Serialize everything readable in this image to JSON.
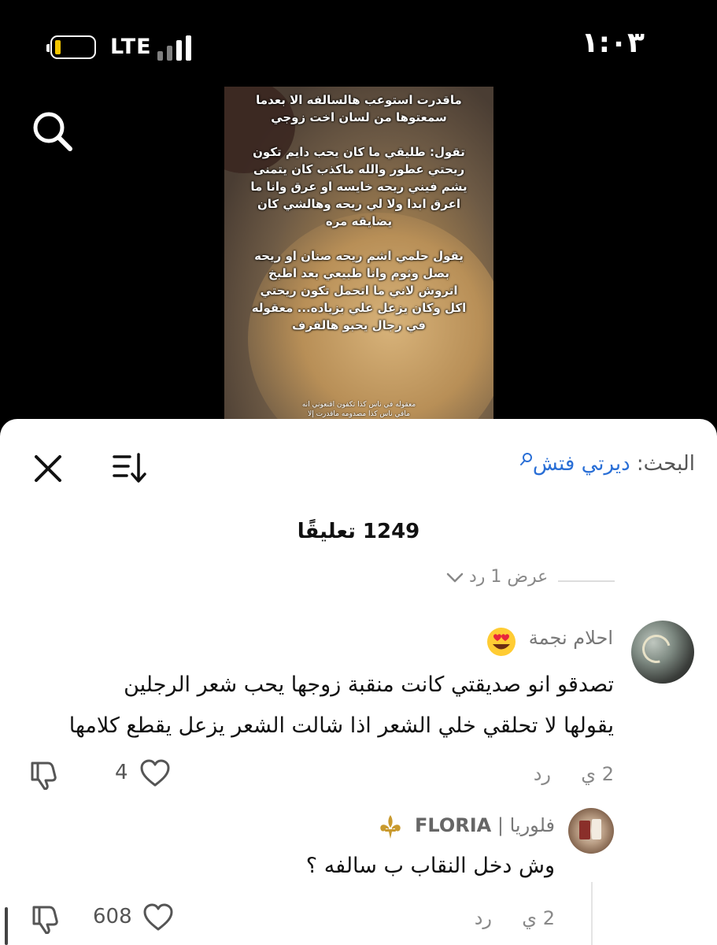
{
  "status_bar": {
    "time": "١:٠٣",
    "network": "LTE",
    "battery_level": 0.15,
    "battery_color": "#f2c500"
  },
  "video": {
    "overlay_text": "ماقدرت استوعب هالسالفه الا بعدما\nسمعتوها من لسان اخت زوجي\n\nتقول: طليقي ما كان يحب دايم تكون\nريحتي عطور والله ماكذب كان يتمنى\nيشم فيني ريحه خايسه او عرق وانا ما\nاعرق ابدا ولا لي ريحه وهالشي كان\nيضايقه مره\n\nيقول حلمي اشم ريحه صنان او ريحه\nبصل وثوم وانا طبيعي بعد اطبخ\nاتروش لاني ما اتحمل تكون ريحتي\nاكل وكان يزعل علي بزياده... معقوله\nفي رجال يحبو هالقرف",
    "small_text": "معقوله في ناس كذا تكفون اقنعوني انه\nمافي ناس كذا مصدومه ماقدرت إلا\nلازم انزل البوست لكم"
  },
  "sheet": {
    "search_label": "البحث:",
    "search_term": "ديرتي فتش",
    "comment_count": "1249 تعليقًا",
    "view_replies": "عرض 1 رد",
    "comments": [
      {
        "author": "احلام نجمة",
        "emoji": "heart-eyes-emoji",
        "lines": [
          "تصدقو انو صديقتي كانت منقبة زوجها يحب شعر الرجلين",
          "يقولها لا تحلقي خلي الشعر اذا شالت الشعر يزعل يقطع كلامها"
        ],
        "age": "2 ي",
        "reply_label": "رد",
        "likes": "4"
      },
      {
        "author_brand": "FLORIA",
        "author_sep": " | ",
        "author_name": "فلوريا",
        "text": "وش دخل النقاب ب سالفه ؟",
        "age": "2 ي",
        "reply_label": "رد",
        "likes": "608"
      }
    ]
  },
  "colors": {
    "link": "#2a6fd6",
    "meta_text": "#888888"
  }
}
